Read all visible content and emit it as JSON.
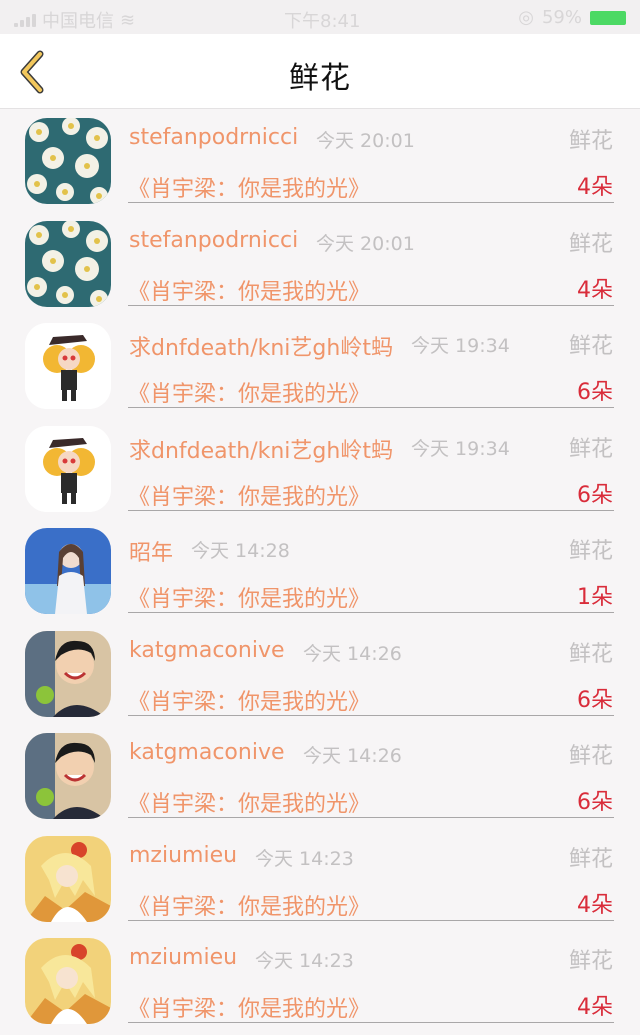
{
  "status_bar": {
    "carrier": "中国电信",
    "time": "下午8:41",
    "battery": "59%"
  },
  "header": {
    "title": "鲜花",
    "back_icon": "chevron-left-icon"
  },
  "colors": {
    "accent": "#f0956a",
    "count": "#d92c3a",
    "muted": "#c3c1c2",
    "back_icon": "#f2c75c"
  },
  "gifts": [
    {
      "user": "stefanpodrnicci",
      "time": "今天 20:01",
      "gift": "鲜花",
      "song": "《肖宇梁：你是我的光》",
      "count": "4朵",
      "avatar": "daisy-avatar"
    },
    {
      "user": "stefanpodrnicci",
      "time": "今天 20:01",
      "gift": "鲜花",
      "song": "《肖宇梁：你是我的光》",
      "count": "4朵",
      "avatar": "daisy-avatar"
    },
    {
      "user": "求dnfdeath/kni艺gh岭t蚂",
      "time": "今天 19:34",
      "gift": "鲜花",
      "song": "《肖宇梁：你是我的光》",
      "count": "6朵",
      "avatar": "anime-girl-avatar"
    },
    {
      "user": "求dnfdeath/kni艺gh岭t蚂",
      "time": "今天 19:34",
      "gift": "鲜花",
      "song": "《肖宇梁：你是我的光》",
      "count": "6朵",
      "avatar": "anime-girl-avatar"
    },
    {
      "user": "昭年",
      "time": "今天 14:28",
      "gift": "鲜花",
      "song": "《肖宇梁：你是我的光》",
      "count": "1朵",
      "avatar": "singer-photo-avatar"
    },
    {
      "user": "katgmaconive",
      "time": "今天 14:26",
      "gift": "鲜花",
      "song": "《肖宇梁：你是我的光》",
      "count": "6朵",
      "avatar": "man-portrait-avatar"
    },
    {
      "user": "katgmaconive",
      "time": "今天 14:26",
      "gift": "鲜花",
      "song": "《肖宇梁：你是我的光》",
      "count": "6朵",
      "avatar": "man-portrait-avatar"
    },
    {
      "user": "mziumieu",
      "time": "今天 14:23",
      "gift": "鲜花",
      "song": "《肖宇梁：你是我的光》",
      "count": "4朵",
      "avatar": "anime-blonde-avatar"
    },
    {
      "user": "mziumieu",
      "time": "今天 14:23",
      "gift": "鲜花",
      "song": "《肖宇梁：你是我的光》",
      "count": "4朵",
      "avatar": "anime-blonde-avatar"
    }
  ]
}
